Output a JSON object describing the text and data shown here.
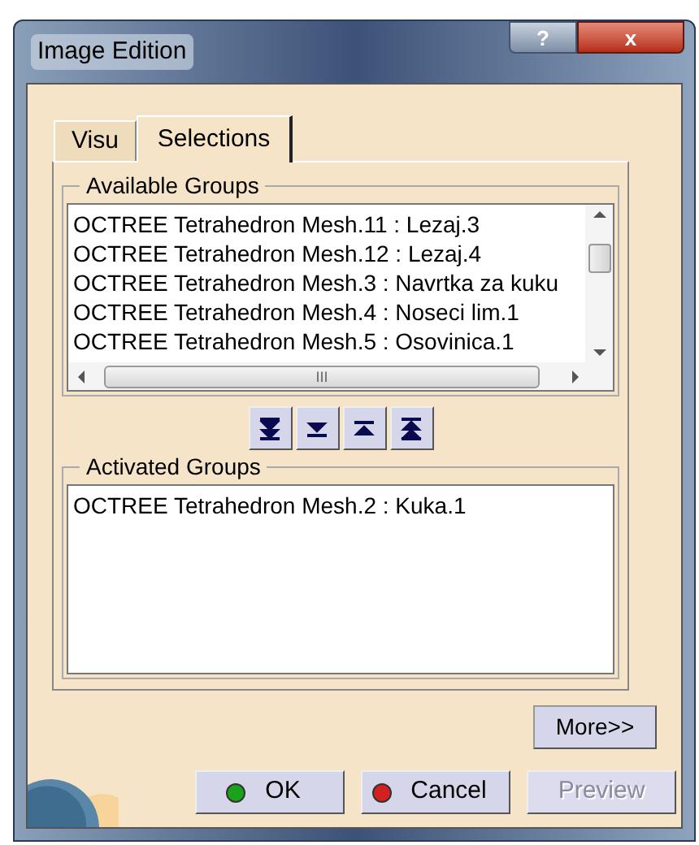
{
  "window": {
    "title": "Image Edition",
    "controls": [
      "?",
      "x"
    ]
  },
  "tabs": [
    {
      "label": "Visu",
      "selected": false
    },
    {
      "label": "Selections",
      "selected": true
    }
  ],
  "available_groups": {
    "label": "Available Groups",
    "items": [
      "OCTREE Tetrahedron Mesh.11 : Lezaj.3",
      "OCTREE Tetrahedron Mesh.12 : Lezaj.4",
      "OCTREE Tetrahedron Mesh.3 : Navrtka za kuku",
      "OCTREE Tetrahedron Mesh.4 : Noseci lim.1",
      "OCTREE Tetrahedron Mesh.5 : Osovinica.1"
    ],
    "scroll_label": "III"
  },
  "move_buttons": [
    {
      "kind": "bottom"
    },
    {
      "kind": "down"
    },
    {
      "kind": "up"
    },
    {
      "kind": "top"
    }
  ],
  "activated_groups": {
    "label": "Activated Groups",
    "items": [
      "OCTREE Tetrahedron Mesh.2 : Kuka.1"
    ]
  },
  "more_button": "More>>",
  "buttons": [
    {
      "label": "OK",
      "kind": "ok",
      "disabled": false
    },
    {
      "label": "Cancel",
      "kind": "cancel",
      "disabled": false
    },
    {
      "label": "Preview",
      "kind": "plain",
      "disabled": true
    }
  ]
}
